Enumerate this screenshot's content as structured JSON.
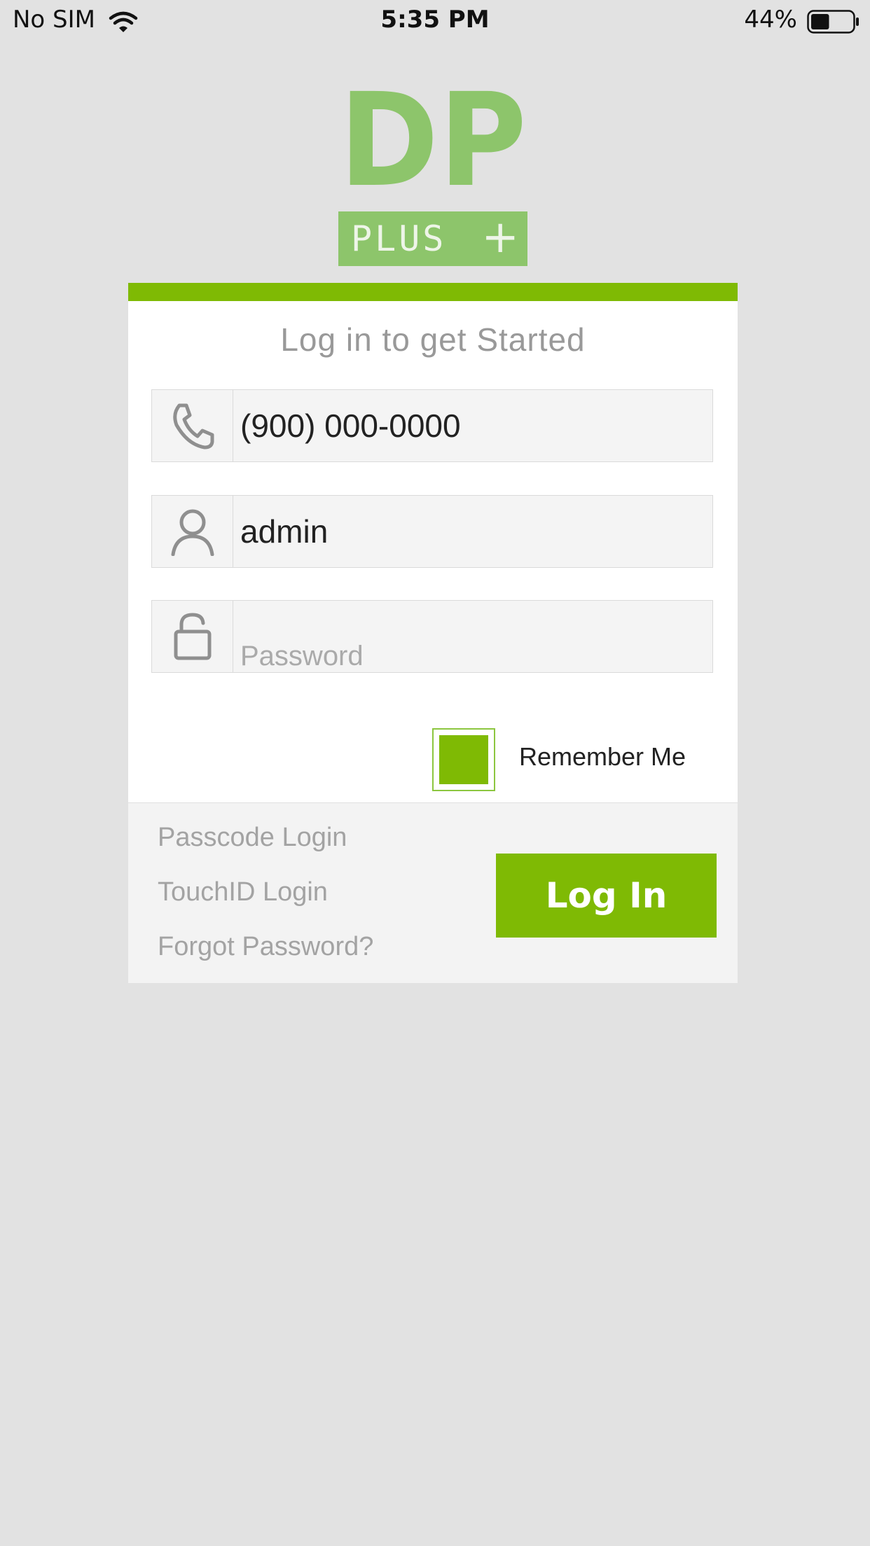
{
  "status_bar": {
    "carrier": "No SIM",
    "time": "5:35 PM",
    "battery_percent": "44%",
    "battery_level": 0.44
  },
  "logo": {
    "brand": "DP",
    "sub_brand": "PLUS",
    "plus_sign": "+",
    "color": "#8dc56b"
  },
  "login_card": {
    "title": "Log in to get Started",
    "accent_color": "#7fba04",
    "phone_field": {
      "value": "(900) 000-0000",
      "icon": "phone-icon"
    },
    "username_field": {
      "value": "admin",
      "icon": "user-icon"
    },
    "password_field": {
      "placeholder": "Password",
      "value": "",
      "icon": "unlock-icon"
    },
    "remember_me": {
      "label": "Remember Me",
      "checked": true
    },
    "links": {
      "passcode_login": "Passcode Login",
      "touchid_login": "TouchID Login",
      "forgot_password": "Forgot Password?"
    },
    "login_button": "Log In"
  }
}
